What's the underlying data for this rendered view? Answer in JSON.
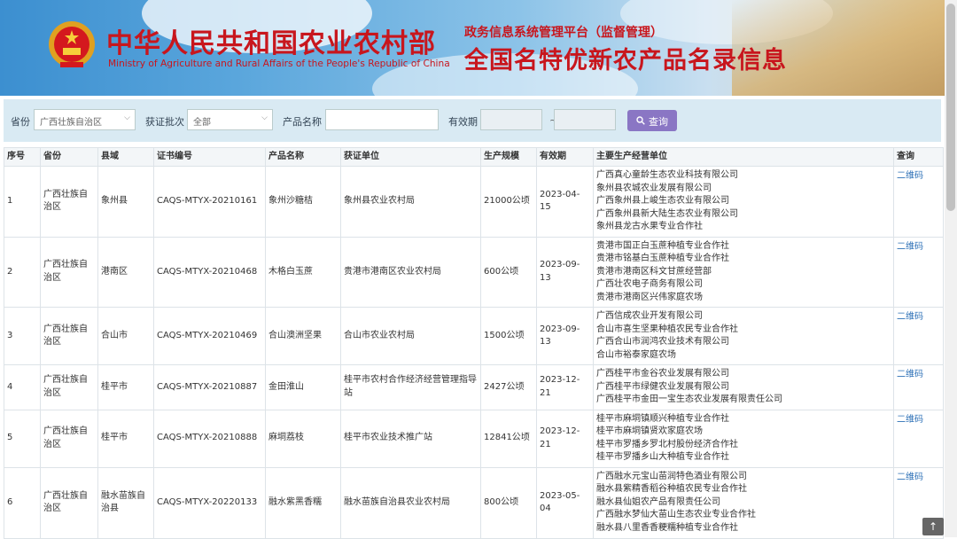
{
  "header": {
    "ministry_cn": "中华人民共和国农业农村部",
    "ministry_en": "Ministry of Agriculture and Rural Affairs of the People's Republic of China",
    "system_subtitle": "政务信息系统管理平台（监督管理）",
    "system_title": "全国名特优新农产品名录信息"
  },
  "filters": {
    "province_label": "省份",
    "province_value": "广西壮族自治区",
    "batch_label": "获证批次",
    "batch_value": "全部",
    "product_label": "产品名称",
    "product_value": "",
    "validity_label": "有效期",
    "date_sep": "~",
    "query_label": "查询"
  },
  "table": {
    "headers": [
      "序号",
      "省份",
      "县域",
      "证书编号",
      "产品名称",
      "获证单位",
      "生产规模",
      "有效期",
      "主要生产经营单位",
      "查询"
    ],
    "rows": [
      {
        "no": "1",
        "province": "广西壮族自治区",
        "county": "象州县",
        "cert": "CAQS-MTYX-20210161",
        "product": "象州沙糖桔",
        "unit": "象州县农业农村局",
        "scale": "21000公顷",
        "valid": "2023-04-15",
        "producers": [
          "广西真心童龄生态农业科技有限公司",
          "象州县农城农业发展有限公司",
          "广西象州县上峻生态农业有限公司",
          "广西象州县新大陆生态农业有限公司",
          "象州县龙古水果专业合作社"
        ],
        "query": "二维码"
      },
      {
        "no": "2",
        "province": "广西壮族自治区",
        "county": "港南区",
        "cert": "CAQS-MTYX-20210468",
        "product": "木格白玉蔗",
        "unit": "贵港市港南区农业农村局",
        "scale": "600公顷",
        "valid": "2023-09-13",
        "producers": [
          "贵港市国正白玉蔗种植专业合作社",
          "贵港市铭基白玉蔗种植专业合作社",
          "贵港市港南区科文甘蔗经营部",
          "广西壮农电子商务有限公司",
          "贵港市港南区兴伟家庭农场"
        ],
        "query": "二维码"
      },
      {
        "no": "3",
        "province": "广西壮族自治区",
        "county": "合山市",
        "cert": "CAQS-MTYX-20210469",
        "product": "合山澳洲坚果",
        "unit": "合山市农业农村局",
        "scale": "1500公顷",
        "valid": "2023-09-13",
        "producers": [
          "广西信成农业开发有限公司",
          "合山市喜生坚果种植农民专业合作社",
          "广西合山市润鸿农业技术有限公司",
          "合山市裕泰家庭农场"
        ],
        "query": "二维码"
      },
      {
        "no": "4",
        "province": "广西壮族自治区",
        "county": "桂平市",
        "cert": "CAQS-MTYX-20210887",
        "product": "金田淮山",
        "unit": "桂平市农村合作经济经营管理指导站",
        "scale": "2427公顷",
        "valid": "2023-12-21",
        "producers": [
          "广西桂平市金谷农业发展有限公司",
          "广西桂平市绿健农业发展有限公司",
          "广西桂平市金田一宝生态农业发展有限责任公司"
        ],
        "query": "二维码"
      },
      {
        "no": "5",
        "province": "广西壮族自治区",
        "county": "桂平市",
        "cert": "CAQS-MTYX-20210888",
        "product": "麻垌荔枝",
        "unit": "桂平市农业技术推广站",
        "scale": "12841公顷",
        "valid": "2023-12-21",
        "producers": [
          "桂平市麻垌镇顺兴种植专业合作社",
          "桂平市麻垌镇贤欢家庭农场",
          "桂平市罗播乡罗北村股份经济合作社",
          "桂平市罗播乡山大种植专业合作社"
        ],
        "query": "二维码"
      },
      {
        "no": "6",
        "province": "广西壮族自治区",
        "county": "融水苗族自治县",
        "cert": "CAQS-MTYX-20220133",
        "product": "融水紫黑香糯",
        "unit": "融水苗族自治县农业农村局",
        "scale": "800公顷",
        "valid": "2023-05-04",
        "producers": [
          "广西融水元宝山苗润特色酒业有限公司",
          "融水县紫精香稻谷种植农民专业合作社",
          "融水县仙姐农产品有限责任公司",
          "广西融水梦仙大苗山生态农业专业合作社",
          "融水县八里香香粳糯种植专业合作社"
        ],
        "query": "二维码"
      }
    ]
  },
  "icons": {
    "search": "search-icon",
    "caret": "chevron-down-icon",
    "to_top": "arrow-up-icon"
  },
  "colors": {
    "brand_red": "#c8161d",
    "query_button": "#8a76c4",
    "link": "#2b6fb6"
  }
}
